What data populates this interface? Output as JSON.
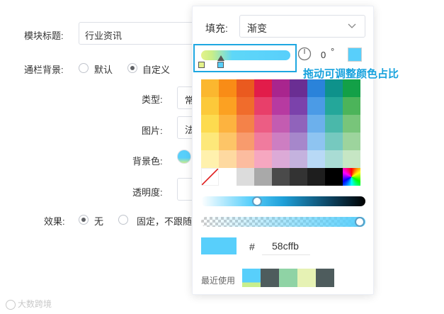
{
  "form": {
    "module_title_label": "模块标题:",
    "module_title_value": "行业资讯",
    "bar_bg_label": "通栏背景:",
    "bar_bg_default": "默认",
    "bar_bg_custom": "自定义",
    "type_label": "类型:",
    "type_value_partial": "常",
    "image_label": "图片:",
    "image_value_partial": "法",
    "bgcolor_label": "背景色:",
    "opacity_label": "透明度:",
    "effect_label": "效果:",
    "effect_none": "无",
    "effect_fixed": "固定，不跟随"
  },
  "picker": {
    "fill_label": "填充:",
    "fill_value": "渐变",
    "angle_value": "0",
    "angle_unit": "°",
    "annotation": "拖动可调整颜色占比",
    "hex_prefix": "#",
    "hex_value": "58cffb",
    "recent_label": "最近使用",
    "current_color": "#58cffb",
    "gradient_stops": [
      "#e4f28a",
      "#58cffb"
    ],
    "swatches": [
      [
        "#fbb72f",
        "#f98c16",
        "#ea5a1f",
        "#e21c4a",
        "#a9258e",
        "#6a2e93",
        "#2a83da",
        "#0e928b",
        "#13a047"
      ],
      [
        "#fcc93a",
        "#fca122",
        "#f06c2c",
        "#e83f6a",
        "#b73aa1",
        "#7b42ab",
        "#4b9be6",
        "#24a79a",
        "#4cb45a"
      ],
      [
        "#fddb4f",
        "#fdb33f",
        "#f48249",
        "#ec5d84",
        "#c35cb1",
        "#9063bb",
        "#6cb0ec",
        "#4ab8aa",
        "#78c57a"
      ],
      [
        "#fde87a",
        "#fdc567",
        "#f89b6d",
        "#f07b9e",
        "#cd7ec2",
        "#a687cb",
        "#8ec4f1",
        "#76c9bf",
        "#9dd49d"
      ],
      [
        "#fff1ad",
        "#fed9a0",
        "#fcbc9f",
        "#f6a7c0",
        "#dcaad7",
        "#c4b2de",
        "#b8d9f6",
        "#a9dcd4",
        "#c6e6c4"
      ],
      [
        "none",
        "#ffffff",
        "#dcdcdc",
        "#a9a9a9",
        "#4a4a4a",
        "#333333",
        "#1e1e1e",
        "#000000",
        "spectrum"
      ]
    ],
    "recent_colors": [
      "#58cffb",
      "#4e5c5d",
      "#8fd3a5",
      "#e6f2b4",
      "#4e5c5d"
    ]
  },
  "watermark": "大数跨境"
}
